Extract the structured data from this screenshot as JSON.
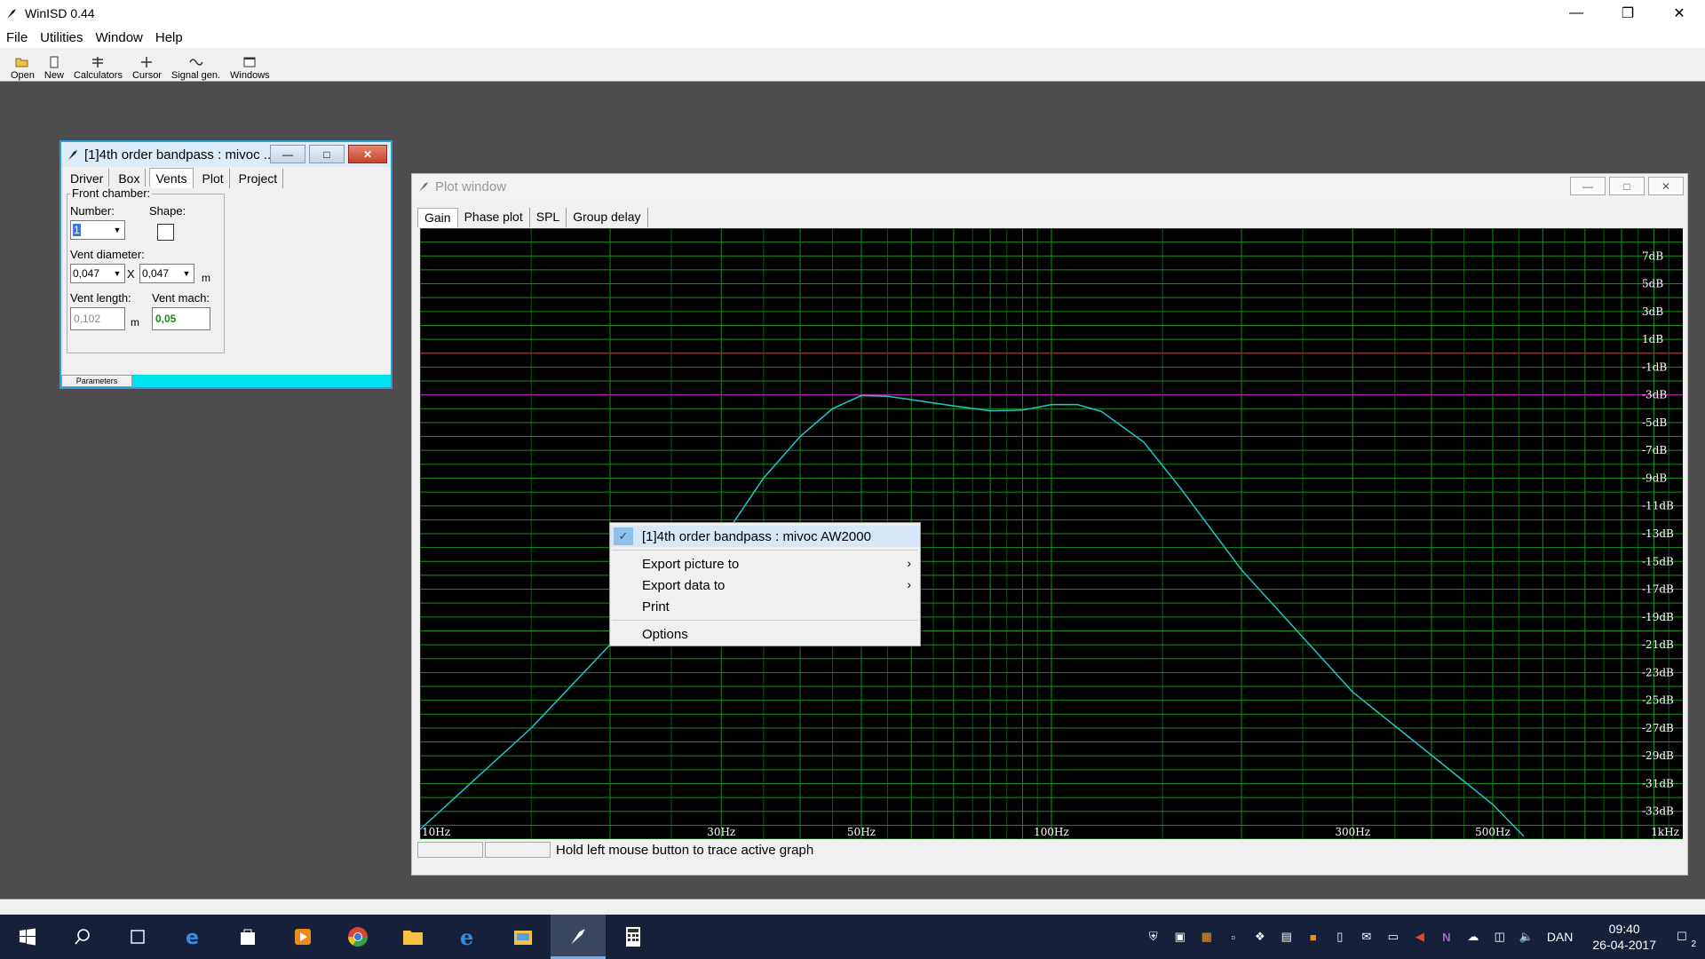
{
  "app": {
    "title": "WinISD 0.44",
    "menu": [
      "File",
      "Utilities",
      "Window",
      "Help"
    ],
    "toolbar": [
      {
        "label": "Open",
        "icon": "folder-open-icon"
      },
      {
        "label": "New",
        "icon": "new-document-icon"
      },
      {
        "label": "Calculators",
        "icon": "calculator-icon"
      },
      {
        "label": "Cursor",
        "icon": "cursor-crosshair-icon"
      },
      {
        "label": "Signal gen.",
        "icon": "signal-generator-icon"
      },
      {
        "label": "Windows",
        "icon": "window-icon"
      }
    ]
  },
  "param_window": {
    "title": "[1]4th order bandpass : mivoc ...",
    "tabs": [
      "Driver",
      "Box",
      "Vents",
      "Plot",
      "Project"
    ],
    "active_tab": "Vents",
    "group_label": "Front chamber:",
    "number_label": "Number:",
    "number_value": "1",
    "shape_label": "Shape:",
    "vent_diameter_label": "Vent diameter:",
    "diameter_a": "0,047",
    "diameter_x": "X",
    "diameter_b": "0,047",
    "unit_m": "m",
    "vent_length_label": "Vent length:",
    "vent_length_value": "0,102",
    "vent_mach_label": "Vent mach:",
    "vent_mach_value": "0,05",
    "status_tab": "Parameters"
  },
  "plot_window": {
    "title": "Plot window",
    "tabs": [
      "Gain",
      "Phase plot",
      "SPL",
      "Group delay"
    ],
    "active_tab": "Gain",
    "status_text": "Hold left mouse button to trace active graph"
  },
  "context_menu": {
    "items": [
      {
        "label": "[1]4th order bandpass : mivoc AW2000",
        "checked": true
      },
      {
        "label": "Export picture to",
        "submenu": true
      },
      {
        "label": "Export data to",
        "submenu": true
      },
      {
        "label": "Print"
      },
      {
        "label": "Options"
      }
    ]
  },
  "chart_data": {
    "type": "line",
    "x_scale": "log",
    "xlim": [
      10,
      1000
    ],
    "ylim": [
      -35,
      9
    ],
    "x_tick_labels": [
      {
        "value": 10,
        "label": "10Hz"
      },
      {
        "value": 30,
        "label": "30Hz"
      },
      {
        "value": 50,
        "label": "50Hz"
      },
      {
        "value": 100,
        "label": "100Hz"
      },
      {
        "value": 300,
        "label": "300Hz"
      },
      {
        "value": 500,
        "label": "500Hz"
      },
      {
        "value": 1000,
        "label": "1kHz"
      }
    ],
    "y_tick_labels": [
      {
        "value": 7,
        "label": "7dB"
      },
      {
        "value": 5,
        "label": "5dB"
      },
      {
        "value": 3,
        "label": "3dB"
      },
      {
        "value": 1,
        "label": "1dB"
      },
      {
        "value": -1,
        "label": "-1dB"
      },
      {
        "value": -3,
        "label": "-3dB"
      },
      {
        "value": -5,
        "label": "-5dB"
      },
      {
        "value": -7,
        "label": "-7dB"
      },
      {
        "value": -9,
        "label": "-9dB"
      },
      {
        "value": -11,
        "label": "-11dB"
      },
      {
        "value": -13,
        "label": "-13dB"
      },
      {
        "value": -15,
        "label": "-15dB"
      },
      {
        "value": -17,
        "label": "-17dB"
      },
      {
        "value": -19,
        "label": "-19dB"
      },
      {
        "value": -21,
        "label": "-21dB"
      },
      {
        "value": -23,
        "label": "-23dB"
      },
      {
        "value": -25,
        "label": "-25dB"
      },
      {
        "value": -27,
        "label": "-27dB"
      },
      {
        "value": -29,
        "label": "-29dB"
      },
      {
        "value": -31,
        "label": "-31dB"
      },
      {
        "value": -33,
        "label": "-33dB"
      }
    ],
    "reference_lines": [
      {
        "y": 0,
        "color": "#c01818"
      },
      {
        "y": -3,
        "color": "#a020a0"
      }
    ],
    "grid": true,
    "background": "#000000",
    "grid_color": "#1a8f1a",
    "series": [
      {
        "color": "#1ec8c8",
        "points": [
          [
            10,
            -34.3
          ],
          [
            15,
            -27
          ],
          [
            20,
            -21
          ],
          [
            30,
            -13.5
          ],
          [
            35,
            -9
          ],
          [
            40,
            -6
          ],
          [
            45,
            -4
          ],
          [
            50,
            -3.05
          ],
          [
            55,
            -3.1
          ],
          [
            70,
            -3.8
          ],
          [
            80,
            -4.15
          ],
          [
            90,
            -4.1
          ],
          [
            100,
            -3.7
          ],
          [
            110,
            -3.7
          ],
          [
            120,
            -4.2
          ],
          [
            140,
            -6.4
          ],
          [
            160,
            -9.7
          ],
          [
            200,
            -15.6
          ],
          [
            300,
            -24.4
          ],
          [
            500,
            -32.5
          ],
          [
            560,
            -34.8
          ]
        ]
      }
    ]
  },
  "taskbar": {
    "language": "DAN",
    "time": "09:40",
    "date": "26-04-2017",
    "notification_count": "2"
  }
}
